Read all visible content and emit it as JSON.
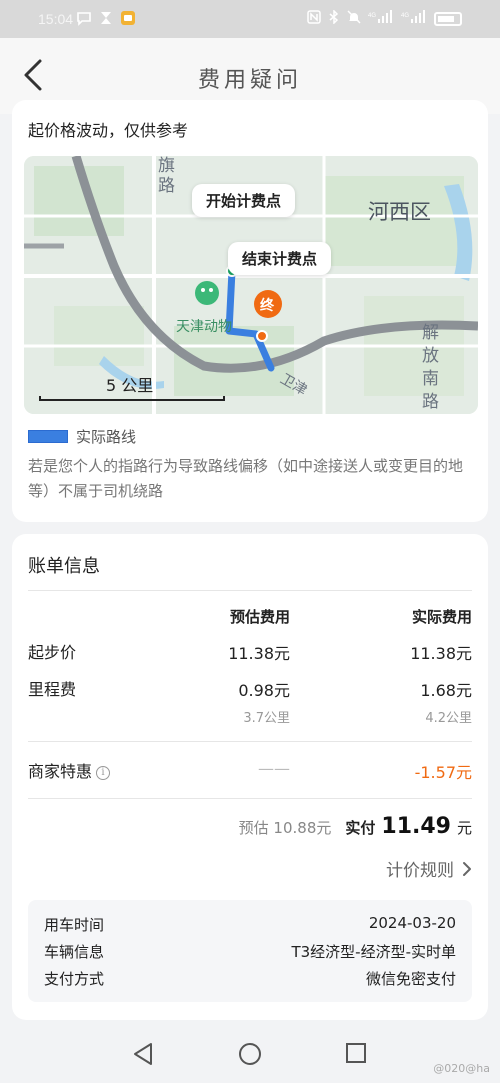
{
  "status_bar": {
    "time": "15:04",
    "left_icons": [
      "msg-icon",
      "hourglass-icon",
      "app-icon"
    ],
    "right_icons": [
      "nfc-icon",
      "bluetooth-icon",
      "mute-icon",
      "4g-signal-icon",
      "4g-signal-icon",
      "battery-icon"
    ]
  },
  "header": {
    "title": "费用疑问"
  },
  "route_card": {
    "top_text": "起价格波动，仅供参考",
    "map": {
      "start_label": "开始计费点",
      "end_label": "结束计费点",
      "end_marker": "终",
      "district_label": "河西区",
      "road_label_1": "解放南路",
      "road_label_2": "旗路",
      "poi_label": "天津动物",
      "scale_label": "5 公里",
      "road_label_3": "卫津"
    },
    "legend_label": "实际路线",
    "note": "若是您个人的指路行为导致路线偏移（如中途接送人或变更目的地等）不属于司机绕路"
  },
  "bill": {
    "title": "账单信息",
    "col_estimated": "预估费用",
    "col_actual": "实际费用",
    "rows": [
      {
        "label": "起步价",
        "estimated": "11.38元",
        "actual": "11.38元"
      },
      {
        "label": "里程费",
        "estimated": "0.98元",
        "actual": "1.68元",
        "estimated_sub": "3.7公里",
        "actual_sub": "4.2公里"
      }
    ],
    "discount": {
      "label": "商家特惠",
      "estimated": "——",
      "actual": "-1.57元"
    },
    "total": {
      "estimated_text": "预估 10.88元",
      "actual_label": "实付",
      "actual_amount": "11.49",
      "actual_unit": "元"
    },
    "rule_link": "计价规则",
    "info": [
      {
        "label": "用车时间",
        "value": "2024-03-20"
      },
      {
        "label": "车辆信息",
        "value": "T3经济型-经济型-实时单"
      },
      {
        "label": "支付方式",
        "value": "微信免密支付"
      }
    ]
  },
  "watermark": "@020@ha",
  "colors": {
    "route": "#3a7fe0",
    "discount": "#f06a12",
    "end_marker": "#f06a12"
  }
}
